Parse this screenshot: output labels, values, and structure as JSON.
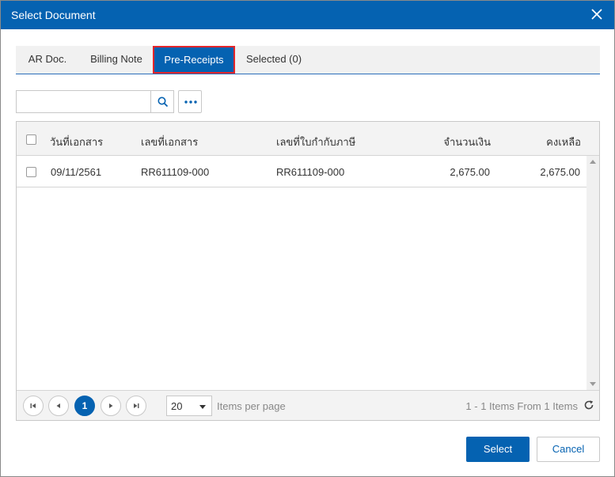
{
  "dialog": {
    "title": "Select Document",
    "close_icon": "close-icon"
  },
  "tabs": [
    {
      "label": "AR Doc.",
      "active": false
    },
    {
      "label": "Billing Note",
      "active": false
    },
    {
      "label": "Pre-Receipts",
      "active": true
    },
    {
      "label": "Selected (0)",
      "active": false
    }
  ],
  "search": {
    "value": "",
    "placeholder": "",
    "search_icon": "search-icon",
    "more_icon": "more-dots-icon"
  },
  "grid": {
    "columns": [
      "วันที่เอกสาร",
      "เลขที่เอกสาร",
      "เลขที่ใบกำกับภาษี",
      "จำนวนเงิน",
      "คงเหลือ"
    ],
    "rows": [
      {
        "checked": false,
        "date": "09/11/2561",
        "doc_no": "RR611109-000",
        "tax_no": "RR611109-000",
        "amount": "2,675.00",
        "balance": "2,675.00"
      }
    ]
  },
  "pager": {
    "current_page": "1",
    "page_size": "20",
    "items_per_page_label": "Items per page",
    "summary": "1 - 1 Items From 1 Items",
    "refresh_icon": "refresh-icon"
  },
  "actions": {
    "select_label": "Select",
    "cancel_label": "Cancel"
  },
  "colors": {
    "primary": "#0562b1",
    "tab_highlight_border": "#e3262b"
  }
}
